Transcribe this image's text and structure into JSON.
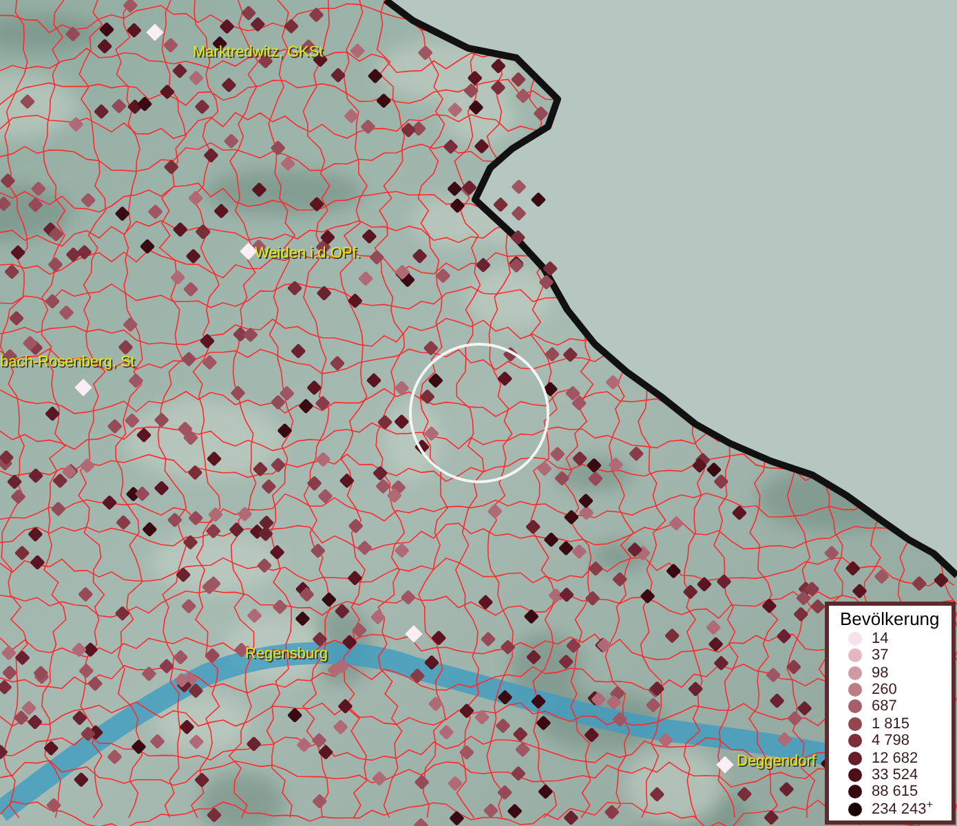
{
  "map": {
    "places": [
      {
        "name": "Marktredwitz, GKSt"
      },
      {
        "name": "Weiden i.d.OPf."
      },
      {
        "name": "bach-Rosenberg, St"
      },
      {
        "name": "Regensburg"
      },
      {
        "name": "Deggendorf"
      }
    ]
  },
  "legend": {
    "title": "Bevölkerung",
    "items": [
      {
        "label": "14",
        "color": "#f6e1ec"
      },
      {
        "label": "37",
        "color": "#e3b8c4"
      },
      {
        "label": "98",
        "color": "#d09aa4"
      },
      {
        "label": "260",
        "color": "#bd7c86"
      },
      {
        "label": "687",
        "color": "#a85e69"
      },
      {
        "label": "1 815",
        "color": "#944650"
      },
      {
        "label": "4 798",
        "color": "#7e2e39"
      },
      {
        "label": "12 682",
        "color": "#671c27"
      },
      {
        "label": "33 524",
        "color": "#4e0f18"
      },
      {
        "label": "88 615",
        "color": "#36070e"
      },
      {
        "label": "234 243$^{+}$",
        "color": "#1c0205"
      }
    ]
  }
}
